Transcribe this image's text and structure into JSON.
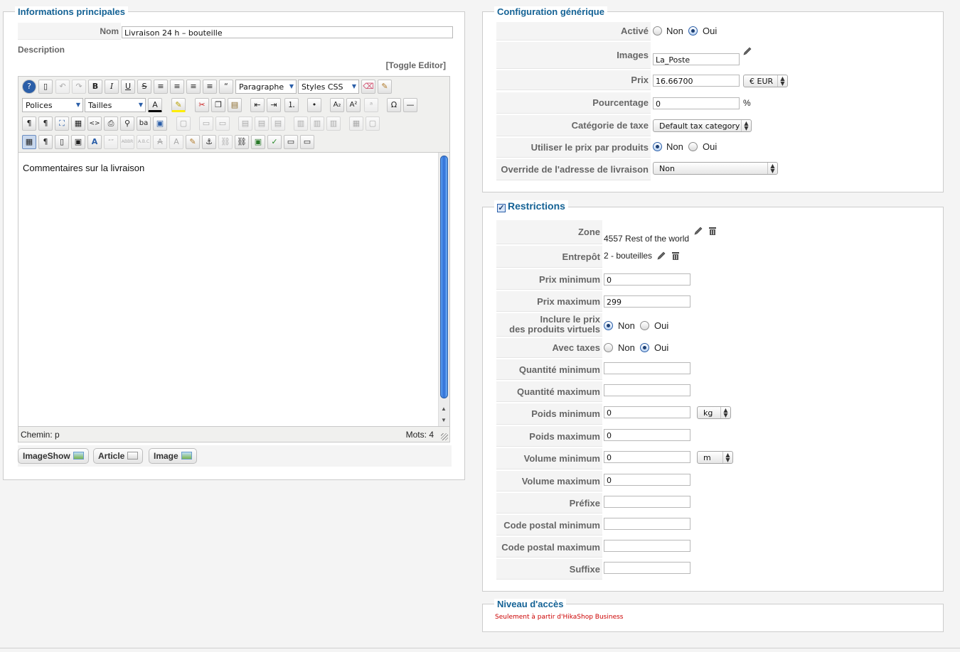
{
  "main_info": {
    "legend": "Informations principales",
    "name_label": "Nom",
    "name_value": "Livraison 24 h – bouteille",
    "description_label": "Description",
    "toggle_editor": "[Toggle Editor]",
    "toolbar": {
      "paragraph_select": "Paragraphe",
      "styles_select": "Styles CSS",
      "fonts_select": "Polices",
      "sizes_select": "Tailles"
    },
    "editor_content": "Commentaires sur la livraison",
    "path_label": "Chemin: p",
    "words_label": "Mots: 4",
    "buttons": {
      "imageshow": "ImageShow",
      "article": "Article",
      "image": "Image"
    }
  },
  "generic_config": {
    "legend": "Configuration générique",
    "active_label": "Activé",
    "active_no": "Non",
    "active_yes": "Oui",
    "active_value": "Oui",
    "images_label": "Images",
    "images_value": "La_Poste",
    "price_label": "Prix",
    "price_value": "16.66700",
    "currency_value": "€ EUR",
    "percentage_label": "Pourcentage",
    "percentage_value": "0",
    "percentage_unit": "%",
    "tax_category_label": "Catégorie de taxe",
    "tax_category_value": "Default tax category",
    "per_product_label": "Utiliser le prix par produits",
    "per_product_no": "Non",
    "per_product_yes": "Oui",
    "per_product_value": "Non",
    "override_label": "Override de l'adresse de livraison",
    "override_value": "Non"
  },
  "restrictions": {
    "legend": "Restrictions",
    "enabled": true,
    "zone_label": "Zone",
    "zone_value": "4557 Rest of the world",
    "warehouse_label": "Entrepôt",
    "warehouse_value": "2 - bouteilles",
    "price_min_label": "Prix minimum",
    "price_min_value": "0",
    "price_max_label": "Prix maximum",
    "price_max_value": "299",
    "virtual_label_1": "Inclure le prix",
    "virtual_label_2": "des produits virtuels",
    "virtual_no": "Non",
    "virtual_yes": "Oui",
    "virtual_value": "Non",
    "taxes_label": "Avec taxes",
    "taxes_no": "Non",
    "taxes_yes": "Oui",
    "taxes_value": "Oui",
    "qty_min_label": "Quantité minimum",
    "qty_min_value": "",
    "qty_max_label": "Quantité maximum",
    "qty_max_value": "",
    "weight_min_label": "Poids minimum",
    "weight_min_value": "0",
    "weight_unit": "kg",
    "weight_max_label": "Poids maximum",
    "weight_max_value": "0",
    "volume_min_label": "Volume minimum",
    "volume_min_value": "0",
    "volume_unit": "m",
    "volume_max_label": "Volume maximum",
    "volume_max_value": "0",
    "prefix_label": "Préfixe",
    "prefix_value": "",
    "zip_min_label": "Code postal minimum",
    "zip_min_value": "",
    "zip_max_label": "Code postal maximum",
    "zip_max_value": "",
    "suffix_label": "Suffixe",
    "suffix_value": ""
  },
  "access_level": {
    "legend": "Niveau d'accès",
    "note": "Seulement à partir d'HikaShop Business",
    "note_color": "#cc0000"
  },
  "colors": {
    "legend_blue": "#146295",
    "radio_blue": "#2a5ea8"
  }
}
